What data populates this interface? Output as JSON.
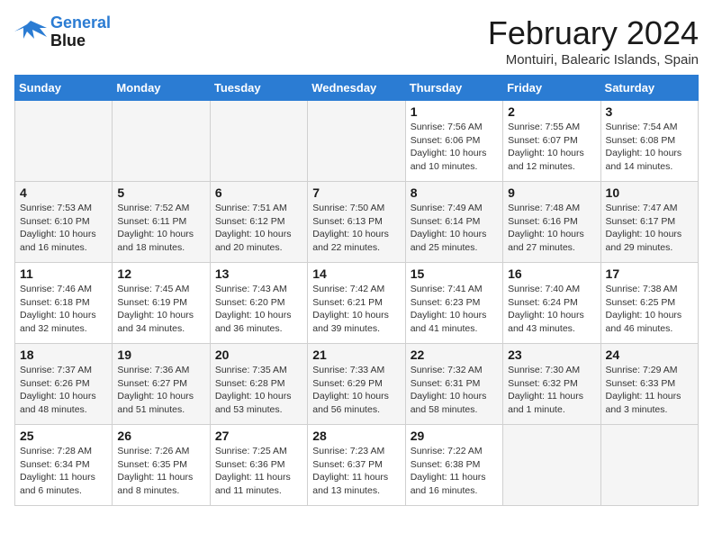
{
  "header": {
    "logo_line1": "General",
    "logo_line2": "Blue",
    "title": "February 2024",
    "subtitle": "Montuiri, Balearic Islands, Spain"
  },
  "days_of_week": [
    "Sunday",
    "Monday",
    "Tuesday",
    "Wednesday",
    "Thursday",
    "Friday",
    "Saturday"
  ],
  "weeks": [
    {
      "days": [
        {
          "num": "",
          "info": ""
        },
        {
          "num": "",
          "info": ""
        },
        {
          "num": "",
          "info": ""
        },
        {
          "num": "",
          "info": ""
        },
        {
          "num": "1",
          "info": "Sunrise: 7:56 AM\nSunset: 6:06 PM\nDaylight: 10 hours\nand 10 minutes."
        },
        {
          "num": "2",
          "info": "Sunrise: 7:55 AM\nSunset: 6:07 PM\nDaylight: 10 hours\nand 12 minutes."
        },
        {
          "num": "3",
          "info": "Sunrise: 7:54 AM\nSunset: 6:08 PM\nDaylight: 10 hours\nand 14 minutes."
        }
      ]
    },
    {
      "days": [
        {
          "num": "4",
          "info": "Sunrise: 7:53 AM\nSunset: 6:10 PM\nDaylight: 10 hours\nand 16 minutes."
        },
        {
          "num": "5",
          "info": "Sunrise: 7:52 AM\nSunset: 6:11 PM\nDaylight: 10 hours\nand 18 minutes."
        },
        {
          "num": "6",
          "info": "Sunrise: 7:51 AM\nSunset: 6:12 PM\nDaylight: 10 hours\nand 20 minutes."
        },
        {
          "num": "7",
          "info": "Sunrise: 7:50 AM\nSunset: 6:13 PM\nDaylight: 10 hours\nand 22 minutes."
        },
        {
          "num": "8",
          "info": "Sunrise: 7:49 AM\nSunset: 6:14 PM\nDaylight: 10 hours\nand 25 minutes."
        },
        {
          "num": "9",
          "info": "Sunrise: 7:48 AM\nSunset: 6:16 PM\nDaylight: 10 hours\nand 27 minutes."
        },
        {
          "num": "10",
          "info": "Sunrise: 7:47 AM\nSunset: 6:17 PM\nDaylight: 10 hours\nand 29 minutes."
        }
      ]
    },
    {
      "days": [
        {
          "num": "11",
          "info": "Sunrise: 7:46 AM\nSunset: 6:18 PM\nDaylight: 10 hours\nand 32 minutes."
        },
        {
          "num": "12",
          "info": "Sunrise: 7:45 AM\nSunset: 6:19 PM\nDaylight: 10 hours\nand 34 minutes."
        },
        {
          "num": "13",
          "info": "Sunrise: 7:43 AM\nSunset: 6:20 PM\nDaylight: 10 hours\nand 36 minutes."
        },
        {
          "num": "14",
          "info": "Sunrise: 7:42 AM\nSunset: 6:21 PM\nDaylight: 10 hours\nand 39 minutes."
        },
        {
          "num": "15",
          "info": "Sunrise: 7:41 AM\nSunset: 6:23 PM\nDaylight: 10 hours\nand 41 minutes."
        },
        {
          "num": "16",
          "info": "Sunrise: 7:40 AM\nSunset: 6:24 PM\nDaylight: 10 hours\nand 43 minutes."
        },
        {
          "num": "17",
          "info": "Sunrise: 7:38 AM\nSunset: 6:25 PM\nDaylight: 10 hours\nand 46 minutes."
        }
      ]
    },
    {
      "days": [
        {
          "num": "18",
          "info": "Sunrise: 7:37 AM\nSunset: 6:26 PM\nDaylight: 10 hours\nand 48 minutes."
        },
        {
          "num": "19",
          "info": "Sunrise: 7:36 AM\nSunset: 6:27 PM\nDaylight: 10 hours\nand 51 minutes."
        },
        {
          "num": "20",
          "info": "Sunrise: 7:35 AM\nSunset: 6:28 PM\nDaylight: 10 hours\nand 53 minutes."
        },
        {
          "num": "21",
          "info": "Sunrise: 7:33 AM\nSunset: 6:29 PM\nDaylight: 10 hours\nand 56 minutes."
        },
        {
          "num": "22",
          "info": "Sunrise: 7:32 AM\nSunset: 6:31 PM\nDaylight: 10 hours\nand 58 minutes."
        },
        {
          "num": "23",
          "info": "Sunrise: 7:30 AM\nSunset: 6:32 PM\nDaylight: 11 hours\nand 1 minute."
        },
        {
          "num": "24",
          "info": "Sunrise: 7:29 AM\nSunset: 6:33 PM\nDaylight: 11 hours\nand 3 minutes."
        }
      ]
    },
    {
      "days": [
        {
          "num": "25",
          "info": "Sunrise: 7:28 AM\nSunset: 6:34 PM\nDaylight: 11 hours\nand 6 minutes."
        },
        {
          "num": "26",
          "info": "Sunrise: 7:26 AM\nSunset: 6:35 PM\nDaylight: 11 hours\nand 8 minutes."
        },
        {
          "num": "27",
          "info": "Sunrise: 7:25 AM\nSunset: 6:36 PM\nDaylight: 11 hours\nand 11 minutes."
        },
        {
          "num": "28",
          "info": "Sunrise: 7:23 AM\nSunset: 6:37 PM\nDaylight: 11 hours\nand 13 minutes."
        },
        {
          "num": "29",
          "info": "Sunrise: 7:22 AM\nSunset: 6:38 PM\nDaylight: 11 hours\nand 16 minutes."
        },
        {
          "num": "",
          "info": ""
        },
        {
          "num": "",
          "info": ""
        }
      ]
    }
  ]
}
